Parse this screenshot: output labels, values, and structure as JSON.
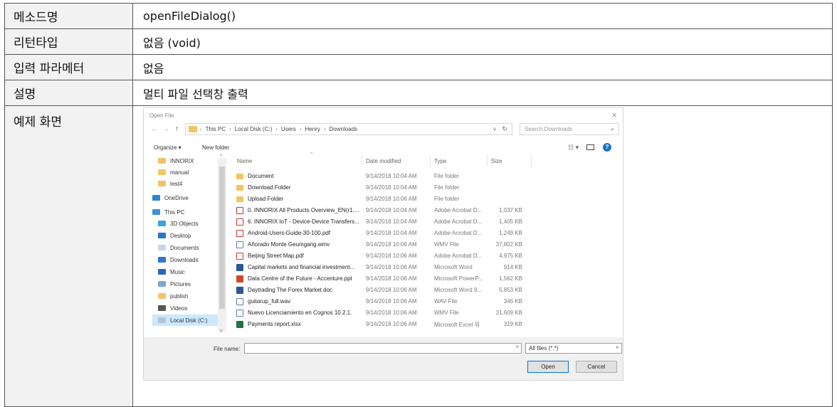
{
  "rows": [
    {
      "key": "메소드명",
      "value": "openFileDialog()"
    },
    {
      "key": "리턴타입",
      "value": "없음 (void)"
    },
    {
      "key": "입력 파라메터",
      "value": "없음"
    },
    {
      "key": "설명",
      "value": "멀티 파일 선택창 출력"
    }
  ],
  "screenshot_label": "예제 화면",
  "dialog": {
    "title": "Open File",
    "close": "×",
    "back": "←",
    "forward": "→",
    "up": "↑",
    "breadcrumb": [
      "This PC",
      "Local Disk (C:)",
      "Users",
      "Henry",
      "Downloads"
    ],
    "crumb_sep": "›",
    "search_placeholder": "Search Downloads",
    "organize": "Organize ▾",
    "new_folder": "New folder",
    "view_toggle": "☷ ▾",
    "help": "?",
    "columns": {
      "name": "Name",
      "date": "Date modified",
      "type": "Type",
      "size": "Size"
    },
    "sort_caret": "^",
    "nav_items": [
      {
        "label": "INNORIX",
        "icon": "folder-icon"
      },
      {
        "label": "manual",
        "icon": "folder-icon"
      },
      {
        "label": "test4",
        "icon": "folder-icon"
      },
      {
        "label": "OneDrive",
        "icon": "cloud-icon"
      },
      {
        "label": "This PC",
        "icon": "pc-icon"
      },
      {
        "label": "3D Objects",
        "icon": "3d-objects-icon"
      },
      {
        "label": "Desktop",
        "icon": "desktop-icon"
      },
      {
        "label": "Documents",
        "icon": "documents-icon"
      },
      {
        "label": "Downloads",
        "icon": "downloads-icon"
      },
      {
        "label": "Music",
        "icon": "music-icon"
      },
      {
        "label": "Pictures",
        "icon": "pictures-icon"
      },
      {
        "label": "publish",
        "icon": "folder-icon"
      },
      {
        "label": "Videos",
        "icon": "videos-icon"
      },
      {
        "label": "Local Disk (C:)",
        "icon": "disk-icon"
      }
    ],
    "nav_up": "^",
    "nav_down": "v",
    "files": [
      {
        "name": "Document",
        "date": "9/14/2018 10:04 AM",
        "type": "File folder",
        "size": "",
        "kind": "folder"
      },
      {
        "name": "Download Folder",
        "date": "9/14/2018 10:04 AM",
        "type": "File folder",
        "size": "",
        "kind": "folder"
      },
      {
        "name": "Upload Folder",
        "date": "9/14/2018 10:06 AM",
        "type": "File folder",
        "size": "",
        "kind": "folder"
      },
      {
        "name": "0. INNORIX All Products Overview_EN(r1....",
        "date": "9/14/2018 10:04 AM",
        "type": "Adobe Acrobat D...",
        "size": "1,037 KB",
        "kind": "pdf"
      },
      {
        "name": "6. INNORIX IoT - Device-Device Transfers...",
        "date": "9/14/2018 10:04 AM",
        "type": "Adobe Acrobat D...",
        "size": "1,405 KB",
        "kind": "pdf"
      },
      {
        "name": "Android-Users-Guide-30-100.pdf",
        "date": "9/14/2018 10:04 AM",
        "type": "Adobe Acrobat D...",
        "size": "1,249 KB",
        "kind": "pdf"
      },
      {
        "name": "Añorado Monte Geumgang.wmv",
        "date": "9/14/2018 10:06 AM",
        "type": "WMV File",
        "size": "37,802 KB",
        "kind": "wmv"
      },
      {
        "name": "Beijing Street Map.pdf",
        "date": "9/14/2018 10:06 AM",
        "type": "Adobe Acrobat D...",
        "size": "4,975 KB",
        "kind": "pdf"
      },
      {
        "name": "Capital markets and financial investment...",
        "date": "9/14/2018 10:06 AM",
        "type": "Microsoft Word",
        "size": "914 KB",
        "kind": "word"
      },
      {
        "name": "Data Centre of the Future - Accenture.ppt",
        "date": "9/14/2018 10:06 AM",
        "type": "Microsoft PowerP...",
        "size": "1,562 KB",
        "kind": "ppt"
      },
      {
        "name": "Daytrading The Forex Market.doc",
        "date": "9/14/2018 10:06 AM",
        "type": "Microsoft Word 9...",
        "size": "5,853 KB",
        "kind": "word"
      },
      {
        "name": "guitarup_full.wav",
        "date": "9/14/2018 10:06 AM",
        "type": "WAV File",
        "size": "346 KB",
        "kind": "wav"
      },
      {
        "name": "Nuevo Licenciamiento en Cognos 10.2.1.",
        "date": "9/14/2018 10:06 AM",
        "type": "WMV File",
        "size": "31,609 KB",
        "kind": "wmv"
      },
      {
        "name": "Payments report.xlsx",
        "date": "9/14/2018 10:06 AM",
        "type": "Microsoft Excel 워",
        "size": "319 KB",
        "kind": "xls"
      }
    ],
    "file_name_label": "File name:",
    "file_name_value": "",
    "filter": "All files (*.*)",
    "dropdown_caret": "v",
    "open_label": "Open",
    "cancel_label": "Cancel"
  }
}
